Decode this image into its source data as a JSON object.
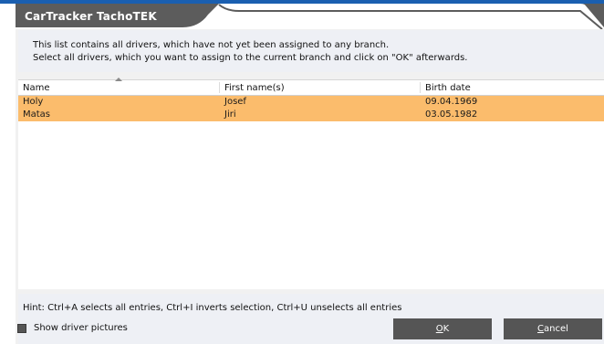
{
  "window": {
    "title": "CarTracker TachoTEK"
  },
  "info": {
    "line1": "This list contains all drivers, which have not yet been assigned to any branch.",
    "line2": "Select all drivers, which you want to assign to the current branch and click on \"OK\" afterwards."
  },
  "table": {
    "columns": [
      "Name",
      "First name(s)",
      "Birth date"
    ],
    "sorted_column": "Name",
    "rows": [
      {
        "name": "Holy",
        "first_name": "Josef",
        "birth_date": "09.04.1969",
        "selected": true
      },
      {
        "name": "Matas",
        "first_name": "Jiri",
        "birth_date": "03.05.1982",
        "selected": true
      }
    ],
    "selection_color": "#fbbc6c"
  },
  "hint": "Hint: Ctrl+A selects all entries, Ctrl+I inverts selection, Ctrl+U unselects all entries",
  "show_pictures": {
    "label": "Show driver pictures",
    "checked": false
  },
  "buttons": {
    "ok_accel": "O",
    "ok_rest": "K",
    "cancel_accel": "C",
    "cancel_rest": "ancel"
  },
  "colors": {
    "title_tab": "#5c5c5c",
    "accent_blue": "#1a5fb0",
    "button": "#555555"
  }
}
